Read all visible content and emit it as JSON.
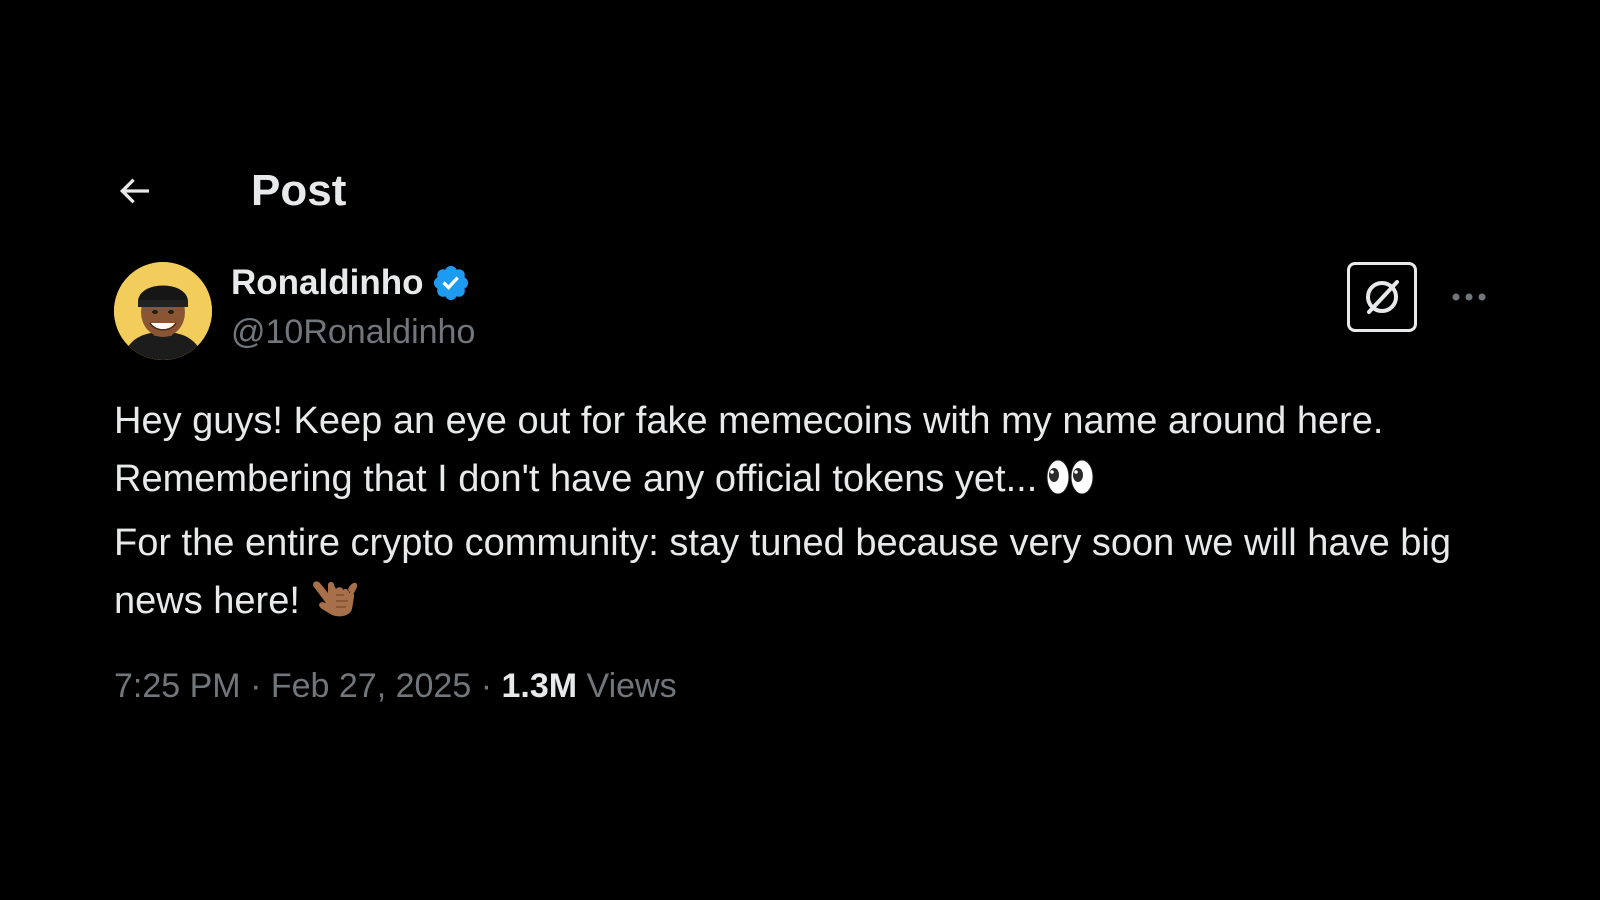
{
  "header": {
    "title": "Post",
    "back_icon": "arrow-left-icon"
  },
  "author": {
    "display_name": "Ronaldinho",
    "handle": "@10Ronaldinho",
    "verified_icon": "verified-badge-icon",
    "verified_color": "#1d9bf0"
  },
  "actions": {
    "grok_icon": "grok-icon",
    "more_icon": "more-horizontal-icon"
  },
  "tweet": {
    "line1": "Hey guys! Keep an eye out for fake memecoins with my name around here. Remembering that I don't have any official tokens yet...",
    "line1_emoji": "👀",
    "line2": "For the entire crypto community: stay tuned because very soon we will have big news here!",
    "line2_emoji": "🤙🏽"
  },
  "meta": {
    "time": "7:25 PM",
    "separator": "·",
    "date": "Feb 27, 2025",
    "views_count": "1.3M",
    "views_label": "Views"
  },
  "colors": {
    "background": "#000000",
    "text_primary": "#e7e9ea",
    "text_secondary": "#71767b",
    "accent": "#1d9bf0"
  }
}
